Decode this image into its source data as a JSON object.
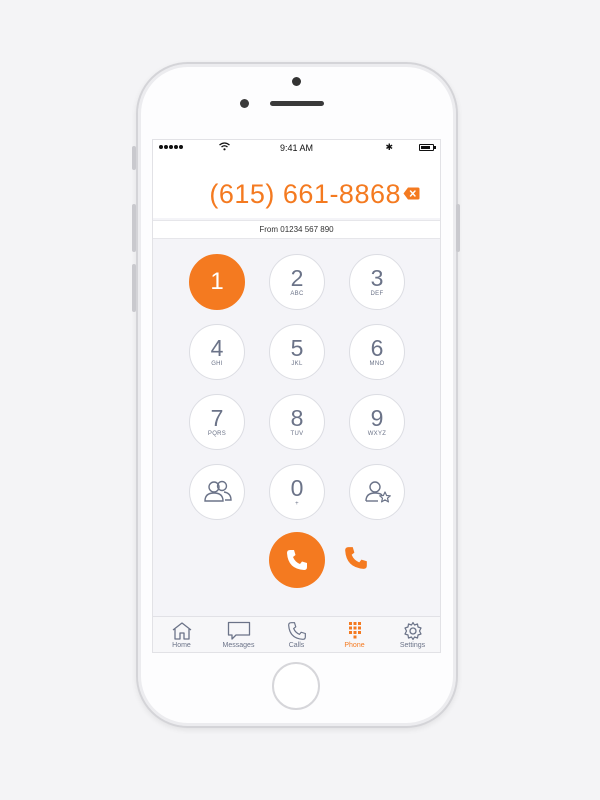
{
  "status_bar": {
    "time": "9:41 AM"
  },
  "dialer": {
    "number": "(615) 661-8868",
    "from_label": "From 01234 567 890"
  },
  "keypad": {
    "k1": {
      "digit": "1",
      "letters": ""
    },
    "k2": {
      "digit": "2",
      "letters": "ABC"
    },
    "k3": {
      "digit": "3",
      "letters": "DEF"
    },
    "k4": {
      "digit": "4",
      "letters": "GHI"
    },
    "k5": {
      "digit": "5",
      "letters": "JKL"
    },
    "k6": {
      "digit": "6",
      "letters": "MNO"
    },
    "k7": {
      "digit": "7",
      "letters": "PQRS"
    },
    "k8": {
      "digit": "8",
      "letters": "TUV"
    },
    "k9": {
      "digit": "9",
      "letters": "WXYZ"
    },
    "k0": {
      "digit": "0",
      "letters": "+"
    }
  },
  "tabs": {
    "home": "Home",
    "messages": "Messages",
    "calls": "Calls",
    "phone": "Phone",
    "settings": "Settings",
    "active": "Phone"
  },
  "icons": {
    "backspace": "backspace-icon",
    "contacts": "contacts-icon",
    "favorite_contact": "favorite-contact-icon",
    "call": "phone-icon",
    "alt_call": "phone-icon",
    "tab_home": "home-icon",
    "tab_messages": "message-bubble-icon",
    "tab_calls": "phone-icon",
    "tab_phone": "keypad-icon",
    "tab_settings": "gear-icon"
  },
  "colors": {
    "accent": "#f47a20",
    "key_text": "#6b7388",
    "background": "#f4f4f8"
  }
}
